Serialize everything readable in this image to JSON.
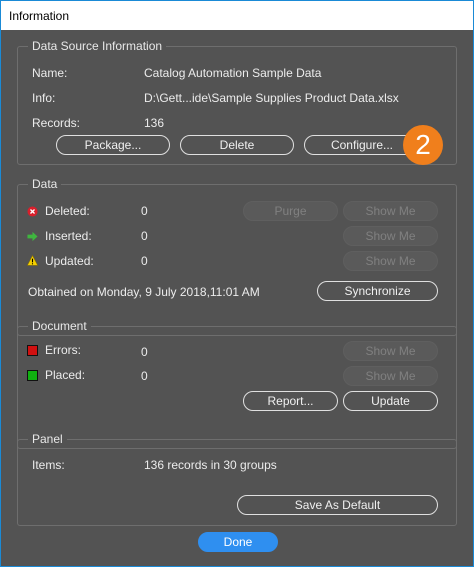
{
  "window": {
    "title": "Information"
  },
  "data_source": {
    "legend": "Data Source Information",
    "name_label": "Name:",
    "name_value": "Catalog Automation Sample Data",
    "info_label": "Info:",
    "info_value": "D:\\Gett...ide\\Sample Supplies Product Data.xlsx",
    "records_label": "Records:",
    "records_value": "136",
    "package_button": "Package...",
    "delete_button": "Delete",
    "configure_button": "Configure..."
  },
  "callout": {
    "number": "2",
    "color": "#f07f1c"
  },
  "data": {
    "legend": "Data",
    "deleted_label": "Deleted:",
    "deleted_value": "0",
    "inserted_label": "Inserted:",
    "inserted_value": "0",
    "updated_label": "Updated:",
    "updated_value": "0",
    "purge_button": "Purge",
    "show_me_button": "Show Me",
    "obtained_text": "Obtained on Monday, 9 July 2018,11:01 AM",
    "synchronize_button": "Synchronize"
  },
  "document": {
    "legend": "Document",
    "errors_label": "Errors:",
    "errors_value": "0",
    "placed_label": "Placed:",
    "placed_value": "0",
    "show_me_button": "Show Me",
    "report_button": "Report...",
    "update_button": "Update"
  },
  "panel": {
    "legend": "Panel",
    "items_label": "Items:",
    "items_value": "136 records in 30 groups",
    "save_default_button": "Save As Default"
  },
  "footer": {
    "done_button": "Done"
  },
  "colors": {
    "accent": "#2f8ff0",
    "error_swatch": "#d01010",
    "placed_swatch": "#10b010",
    "deleted_icon": "#d91f2b",
    "inserted_icon": "#3fb53f",
    "warning_icon": "#f5d000"
  }
}
